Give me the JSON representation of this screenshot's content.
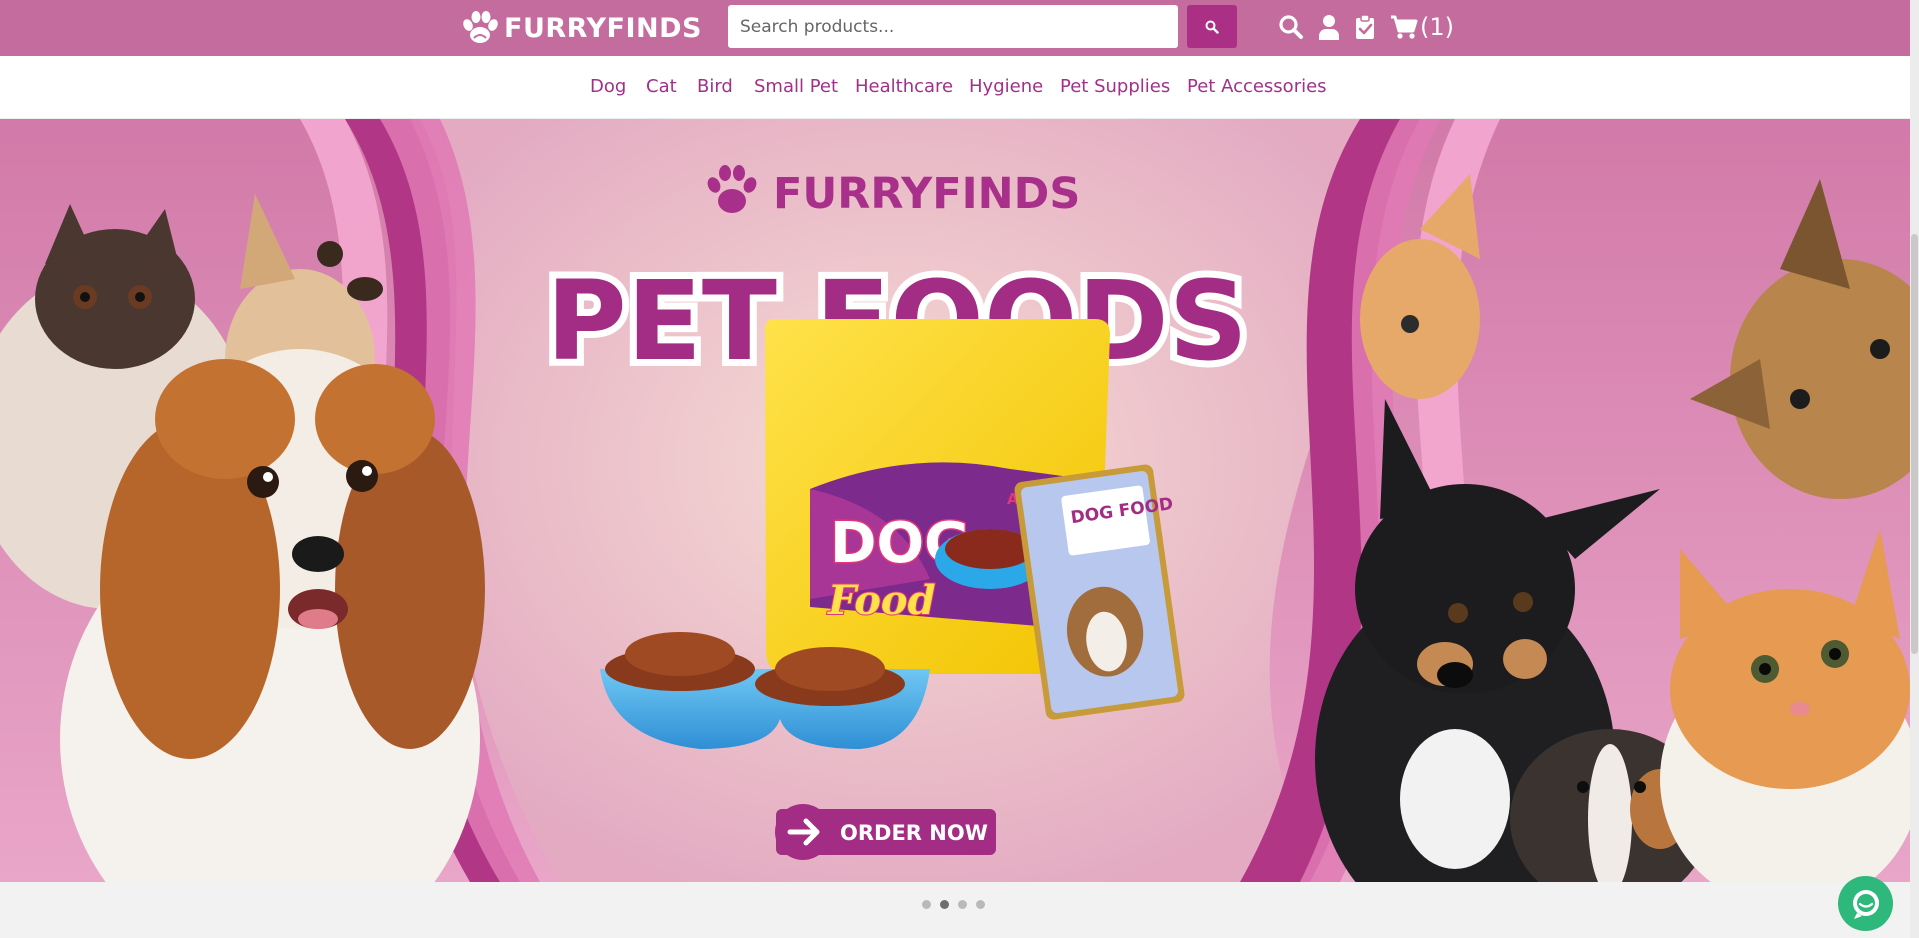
{
  "header": {
    "logo_text": "FURRYFINDS",
    "search": {
      "placeholder": "Search products...",
      "value": ""
    },
    "icons": [
      "search-icon",
      "user-icon",
      "clipboard-check-icon",
      "cart-icon"
    ],
    "cart_count_text": "(1)"
  },
  "nav": {
    "items": [
      "Dog",
      "Cat",
      "Bird",
      "Small Pet",
      "Healthcare",
      "Hygiene",
      "Pet Supplies",
      "Pet Accessories"
    ]
  },
  "hero": {
    "brand_text": "FURRYFINDS",
    "headline": "PET FOODS",
    "bag_text_1": "DOG",
    "bag_text_2": "Food",
    "bag_corner_text": "AD",
    "pouch_text": "DOG FOOD",
    "cta_label": "ORDER NOW"
  },
  "carousel": {
    "slide_count": 4,
    "active_index": 1
  },
  "colors": {
    "topbar": "#c46c9e",
    "accent": "#ab2f84",
    "nav_text": "#a2308a",
    "hero_bg": "#e3a3c3",
    "chat": "#2eb87b"
  }
}
